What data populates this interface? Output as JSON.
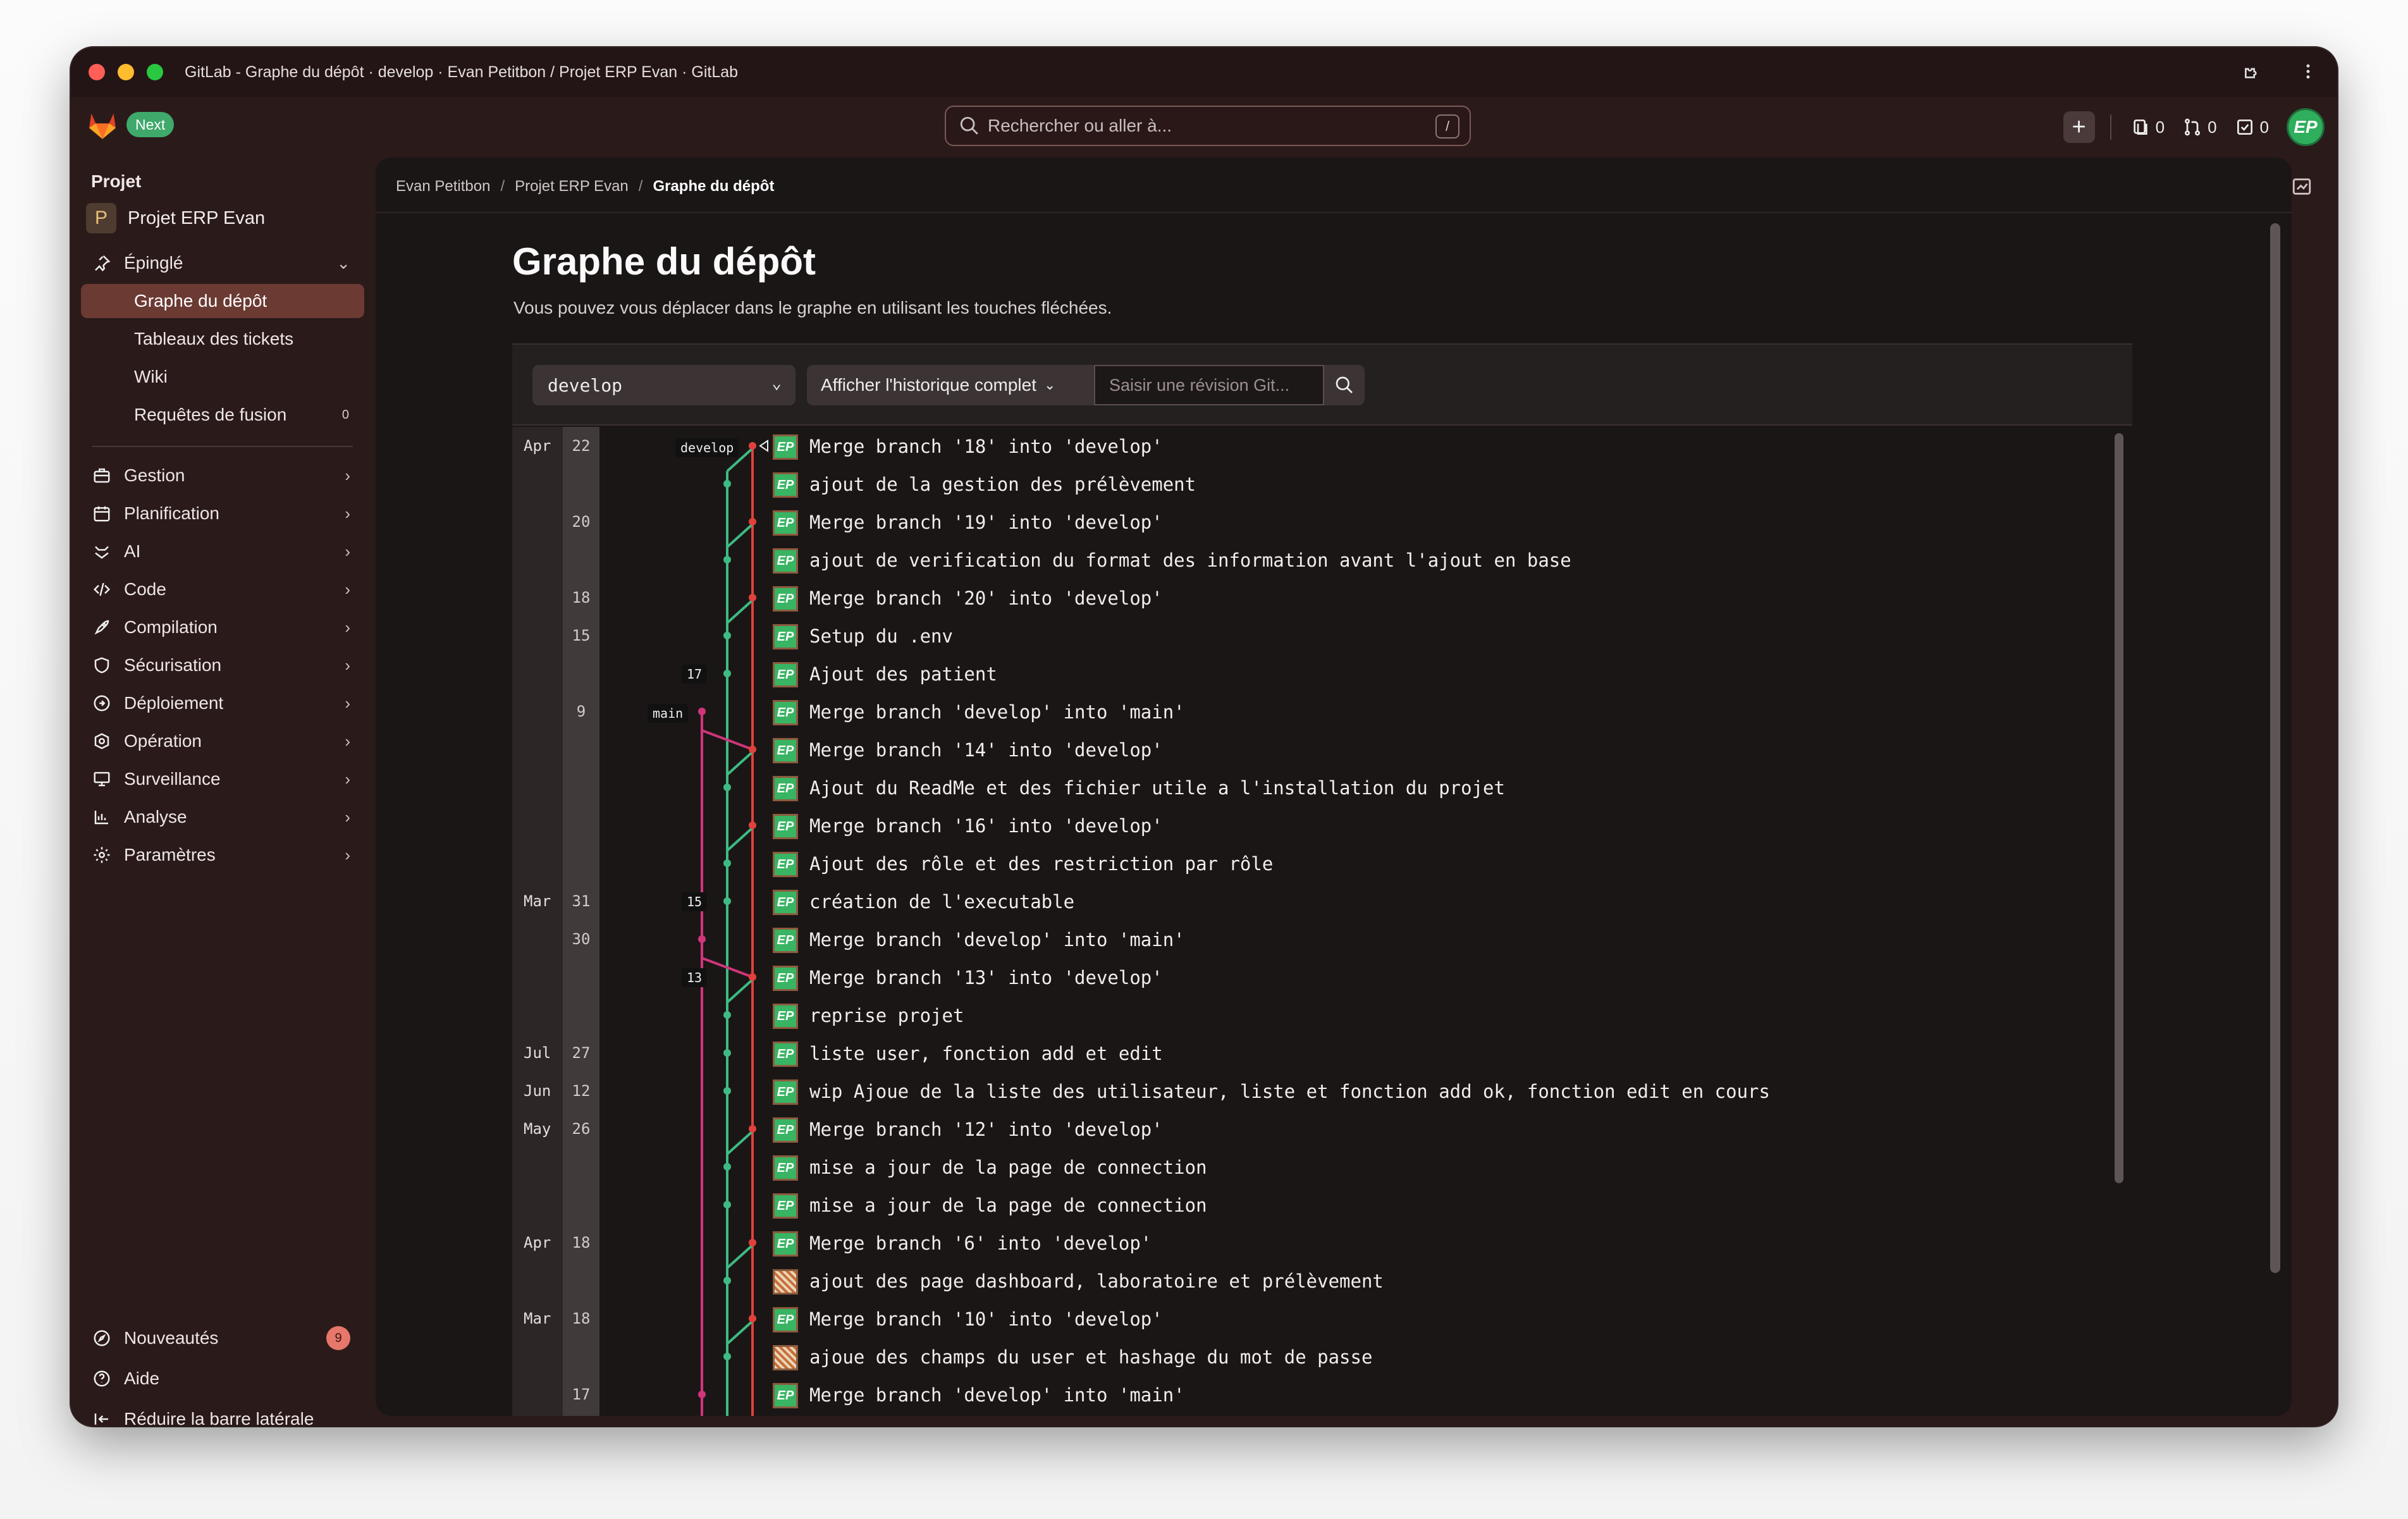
{
  "window": {
    "title": "GitLab - Graphe du dépôt · develop · Evan Petitbon / Projet ERP Evan · GitLab"
  },
  "header": {
    "next_label": "Next",
    "search_placeholder": "Rechercher ou aller à...",
    "search_shortcut": "/",
    "issues_count": "0",
    "mr_count": "0",
    "todos_count": "0",
    "avatar_initials": "EP"
  },
  "sidebar": {
    "section_title": "Projet",
    "project_initial": "P",
    "project_name": "Projet ERP Evan",
    "pinned_label": "Épinglé",
    "pinned_items": [
      {
        "label": "Graphe du dépôt"
      },
      {
        "label": "Tableaux des tickets"
      },
      {
        "label": "Wiki"
      },
      {
        "label": "Requêtes de fusion",
        "count": "0"
      }
    ],
    "nav_items": [
      {
        "label": "Gestion"
      },
      {
        "label": "Planification"
      },
      {
        "label": "AI"
      },
      {
        "label": "Code"
      },
      {
        "label": "Compilation"
      },
      {
        "label": "Sécurisation"
      },
      {
        "label": "Déploiement"
      },
      {
        "label": "Opération"
      },
      {
        "label": "Surveillance"
      },
      {
        "label": "Analyse"
      },
      {
        "label": "Paramètres"
      }
    ],
    "footer": {
      "whats_new": "Nouveautés",
      "whats_new_count": "9",
      "help": "Aide",
      "collapse": "Réduire la barre latérale"
    }
  },
  "breadcrumb": {
    "items": [
      "Evan Petitbon",
      "Projet ERP Evan",
      "Graphe du dépôt"
    ],
    "separator": "/"
  },
  "page": {
    "title": "Graphe du dépôt",
    "description": "Vous pouvez vous déplacer dans le graphe en utilisant les touches fléchées."
  },
  "toolbar": {
    "branch_value": "develop",
    "history_label": "Afficher l'historique complet",
    "revision_placeholder": "Saisir une révision Git..."
  },
  "graph": {
    "refs": {
      "develop": "develop",
      "main": "main"
    },
    "tags": [
      "17",
      "15",
      "13"
    ],
    "commits": [
      {
        "month": "Apr",
        "day": "22",
        "message": "Merge branch '18' into 'develop'"
      },
      {
        "month": "",
        "day": "",
        "message": "ajout de la gestion des prélèvement"
      },
      {
        "month": "",
        "day": "20",
        "message": "Merge branch '19' into 'develop'"
      },
      {
        "month": "",
        "day": "",
        "message": "ajout de verification du format des information avant l'ajout en base"
      },
      {
        "month": "",
        "day": "18",
        "message": "Merge branch '20' into 'develop'"
      },
      {
        "month": "",
        "day": "15",
        "message": "Setup du .env"
      },
      {
        "month": "",
        "day": "",
        "message": "Ajout des patient"
      },
      {
        "month": "",
        "day": "9",
        "message": "Merge branch 'develop' into 'main'"
      },
      {
        "month": "",
        "day": "",
        "message": "Merge branch '14' into 'develop'"
      },
      {
        "month": "",
        "day": "",
        "message": "Ajout du ReadMe et des fichier utile a l'installation du projet"
      },
      {
        "month": "",
        "day": "",
        "message": "Merge branch '16' into 'develop'"
      },
      {
        "month": "",
        "day": "",
        "message": "Ajout des rôle et des restriction par rôle"
      },
      {
        "month": "Mar",
        "day": "31",
        "message": "création de l'executable"
      },
      {
        "month": "",
        "day": "30",
        "message": "Merge branch 'develop' into 'main'"
      },
      {
        "month": "",
        "day": "",
        "message": "Merge branch '13' into 'develop'"
      },
      {
        "month": "",
        "day": "",
        "message": "reprise projet"
      },
      {
        "month": "Jul",
        "day": "27",
        "message": "liste user, fonction add et edit"
      },
      {
        "month": "Jun",
        "day": "12",
        "message": "wip Ajoue de la liste des utilisateur, liste et fonction add ok, fonction edit en cours"
      },
      {
        "month": "May",
        "day": "26",
        "message": "Merge branch '12' into 'develop'"
      },
      {
        "month": "",
        "day": "",
        "message": "mise a jour de la page de connection"
      },
      {
        "month": "",
        "day": "",
        "message": "mise a jour de la page de connection"
      },
      {
        "month": "Apr",
        "day": "18",
        "message": "Merge branch '6' into 'develop'"
      },
      {
        "month": "",
        "day": "",
        "message": "ajout des page dashboard, laboratoire et prélèvement"
      },
      {
        "month": "Mar",
        "day": "18",
        "message": "Merge branch '10' into 'develop'"
      },
      {
        "month": "",
        "day": "",
        "message": "ajoue des champs du user et hashage du mot de passe"
      },
      {
        "month": "",
        "day": "17",
        "message": "Merge branch 'develop' into 'main'"
      }
    ]
  },
  "colors": {
    "accent_active": "#6b3a33",
    "lane_red": "#e0413c",
    "lane_green": "#3dbb83",
    "lane_pink": "#d0357a",
    "avatar_green": "#38b463"
  }
}
